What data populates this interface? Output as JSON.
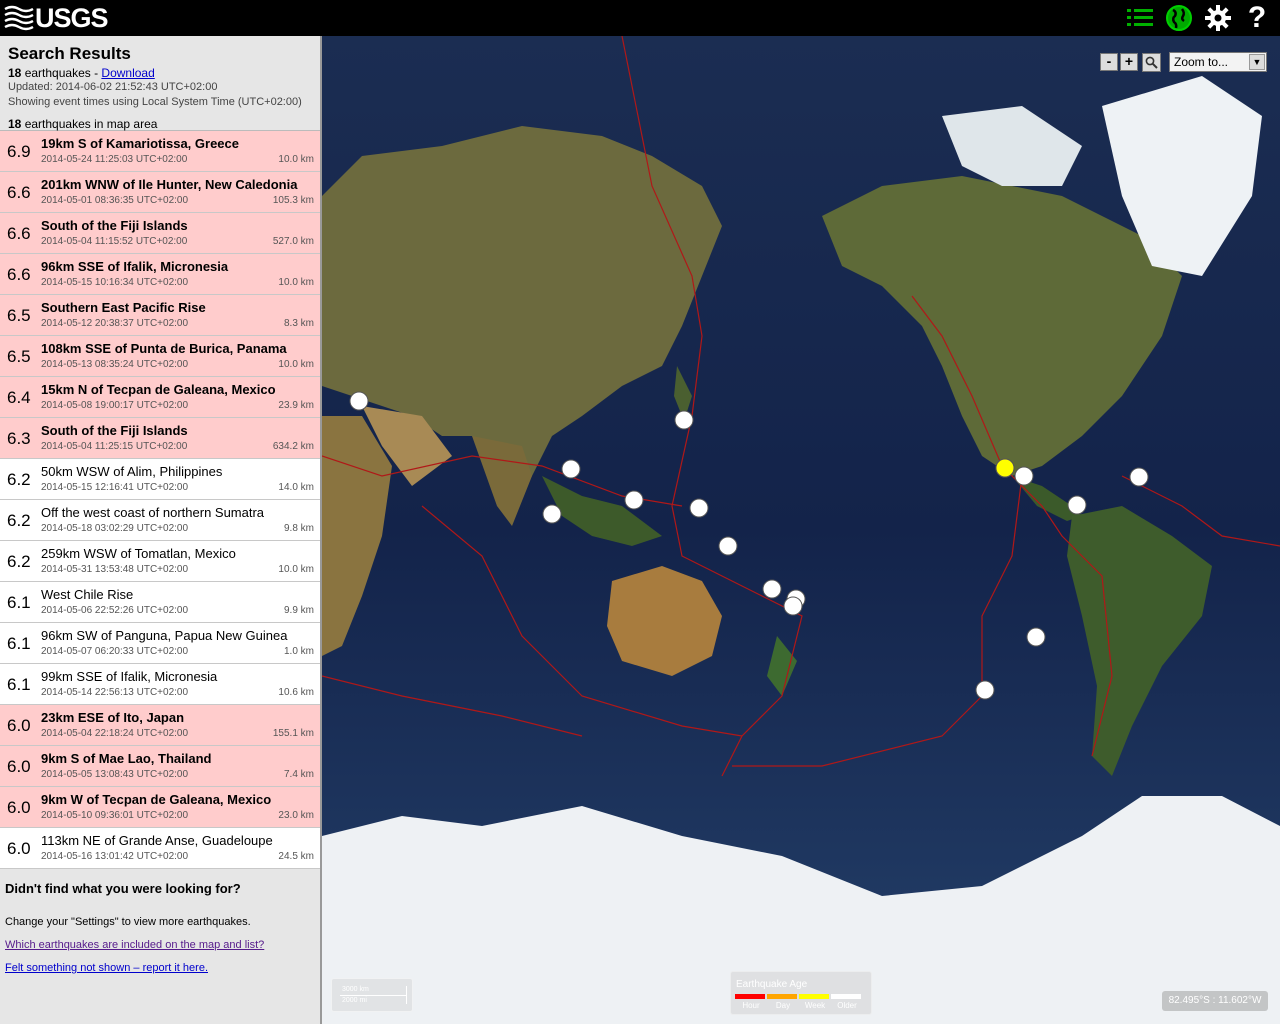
{
  "header": {
    "logo_text": "USGS",
    "icons": [
      "list-icon",
      "globe-icon",
      "gear-icon",
      "help-icon"
    ],
    "help_label": "?",
    "accent": "#00b000"
  },
  "summary": {
    "title": "Search Results",
    "count": "18",
    "count_suffix": " earthquakes - ",
    "download_label": "Download",
    "updated": "Updated: 2014-06-02 21:52:43 UTC+02:00",
    "timezone_note": "Showing event times using Local System Time (UTC+02:00)",
    "in_area_count": "18",
    "in_area_suffix": " earthquakes in map area"
  },
  "earthquakes": [
    {
      "mag": "6.9",
      "place": "19km S of Kamariotissa, Greece",
      "time": "2014-05-24 11:25:03 UTC+02:00",
      "depth": "10.0 km",
      "alert": true
    },
    {
      "mag": "6.6",
      "place": "201km WNW of Ile Hunter, New Caledonia",
      "time": "2014-05-01 08:36:35 UTC+02:00",
      "depth": "105.3 km",
      "alert": true
    },
    {
      "mag": "6.6",
      "place": "South of the Fiji Islands",
      "time": "2014-05-04 11:15:52 UTC+02:00",
      "depth": "527.0 km",
      "alert": true
    },
    {
      "mag": "6.6",
      "place": "96km SSE of Ifalik, Micronesia",
      "time": "2014-05-15 10:16:34 UTC+02:00",
      "depth": "10.0 km",
      "alert": true
    },
    {
      "mag": "6.5",
      "place": "Southern East Pacific Rise",
      "time": "2014-05-12 20:38:37 UTC+02:00",
      "depth": "8.3 km",
      "alert": true
    },
    {
      "mag": "6.5",
      "place": "108km SSE of Punta de Burica, Panama",
      "time": "2014-05-13 08:35:24 UTC+02:00",
      "depth": "10.0 km",
      "alert": true
    },
    {
      "mag": "6.4",
      "place": "15km N of Tecpan de Galeana, Mexico",
      "time": "2014-05-08 19:00:17 UTC+02:00",
      "depth": "23.9 km",
      "alert": true
    },
    {
      "mag": "6.3",
      "place": "South of the Fiji Islands",
      "time": "2014-05-04 11:25:15 UTC+02:00",
      "depth": "634.2 km",
      "alert": true
    },
    {
      "mag": "6.2",
      "place": "50km WSW of Alim, Philippines",
      "time": "2014-05-15 12:16:41 UTC+02:00",
      "depth": "14.0 km",
      "alert": false
    },
    {
      "mag": "6.2",
      "place": "Off the west coast of northern Sumatra",
      "time": "2014-05-18 03:02:29 UTC+02:00",
      "depth": "9.8 km",
      "alert": false
    },
    {
      "mag": "6.2",
      "place": "259km WSW of Tomatlan, Mexico",
      "time": "2014-05-31 13:53:48 UTC+02:00",
      "depth": "10.0 km",
      "alert": false
    },
    {
      "mag": "6.1",
      "place": "West Chile Rise",
      "time": "2014-05-06 22:52:26 UTC+02:00",
      "depth": "9.9 km",
      "alert": false
    },
    {
      "mag": "6.1",
      "place": "96km SW of Panguna, Papua New Guinea",
      "time": "2014-05-07 06:20:33 UTC+02:00",
      "depth": "1.0 km",
      "alert": false
    },
    {
      "mag": "6.1",
      "place": "99km SSE of Ifalik, Micronesia",
      "time": "2014-05-14 22:56:13 UTC+02:00",
      "depth": "10.6 km",
      "alert": false
    },
    {
      "mag": "6.0",
      "place": "23km ESE of Ito, Japan",
      "time": "2014-05-04 22:18:24 UTC+02:00",
      "depth": "155.1 km",
      "alert": true
    },
    {
      "mag": "6.0",
      "place": "9km S of Mae Lao, Thailand",
      "time": "2014-05-05 13:08:43 UTC+02:00",
      "depth": "7.4 km",
      "alert": true
    },
    {
      "mag": "6.0",
      "place": "9km W of Tecpan de Galeana, Mexico",
      "time": "2014-05-10 09:36:01 UTC+02:00",
      "depth": "23.0 km",
      "alert": true
    },
    {
      "mag": "6.0",
      "place": "113km NE of Grande Anse, Guadeloupe",
      "time": "2014-05-16 13:01:42 UTC+02:00",
      "depth": "24.5 km",
      "alert": false
    }
  ],
  "help": {
    "question": "Didn't find what you were looking for?",
    "settings_hint": "Change your \"Settings\" to view more earthquakes.",
    "link_included": "Which earthquakes are included on the map and list?",
    "link_report": "Felt something not shown – report it here."
  },
  "map": {
    "zoom_out": "-",
    "zoom_in": "+",
    "zoom_select": "Zoom to...",
    "scale_km": "3000 km",
    "scale_mi": "2000 mi",
    "legend_title": "Earthquake Age",
    "legend_labels": [
      "Hour",
      "Day",
      "Week",
      "Older"
    ],
    "legend_colors": [
      "#ff0000",
      "#ffa500",
      "#ffff00",
      "#ffffff"
    ],
    "coords": "82.495°S : 11.602°W",
    "marker_color_recent": "#ffff00",
    "marker_color_older": "#ffffff",
    "plate_boundary_color": "#b01818"
  }
}
